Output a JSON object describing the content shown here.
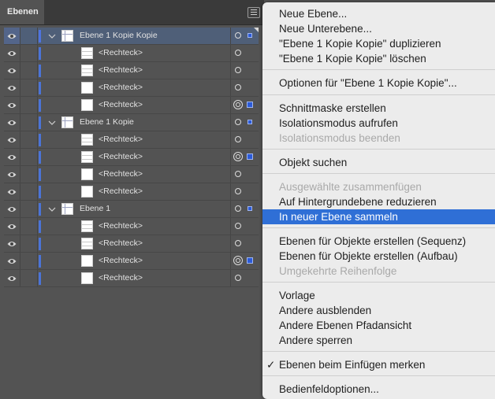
{
  "panel": {
    "tab_label": "Ebenen",
    "accent_color": "#4b74d8",
    "rows": [
      {
        "label": "Ebene 1 Kopie Kopie",
        "kind": "layer",
        "selected": true
      },
      {
        "label": "<Rechteck>",
        "kind": "item"
      },
      {
        "label": "<Rechteck>",
        "kind": "item"
      },
      {
        "label": "<Rechteck>",
        "kind": "item"
      },
      {
        "label": "<Rechteck>",
        "kind": "item"
      },
      {
        "label": "Ebene 1 Kopie",
        "kind": "layer"
      },
      {
        "label": "<Rechteck>",
        "kind": "item"
      },
      {
        "label": "<Rechteck>",
        "kind": "item"
      },
      {
        "label": "<Rechteck>",
        "kind": "item"
      },
      {
        "label": "<Rechteck>",
        "kind": "item"
      },
      {
        "label": "Ebene 1",
        "kind": "layer"
      },
      {
        "label": "<Rechteck>",
        "kind": "item"
      },
      {
        "label": "<Rechteck>",
        "kind": "item"
      },
      {
        "label": "<Rechteck>",
        "kind": "item"
      },
      {
        "label": "<Rechteck>",
        "kind": "item"
      }
    ]
  },
  "menu": {
    "highlight_color": "#2f6fd6",
    "items": [
      {
        "label": "Neue Ebene..."
      },
      {
        "label": "Neue Unterebene..."
      },
      {
        "label": "\"Ebene 1 Kopie Kopie\" duplizieren"
      },
      {
        "label": "\"Ebene 1 Kopie Kopie\" löschen"
      },
      {
        "label": "Optionen für \"Ebene 1 Kopie Kopie\"..."
      },
      {
        "label": "Schnittmaske erstellen"
      },
      {
        "label": "Isolationsmodus aufrufen"
      },
      {
        "label": "Isolationsmodus beenden",
        "disabled": true
      },
      {
        "label": "Objekt suchen"
      },
      {
        "label": "Ausgewählte zusammenfügen",
        "disabled": true
      },
      {
        "label": "Auf Hintergrundebene reduzieren"
      },
      {
        "label": "In neuer Ebene sammeln",
        "highlighted": true
      },
      {
        "label": "Ebenen für Objekte erstellen (Sequenz)"
      },
      {
        "label": "Ebenen für Objekte erstellen (Aufbau)"
      },
      {
        "label": "Umgekehrte Reihenfolge",
        "disabled": true
      },
      {
        "label": "Vorlage"
      },
      {
        "label": "Andere ausblenden"
      },
      {
        "label": "Andere Ebenen Pfadansicht"
      },
      {
        "label": "Andere sperren"
      },
      {
        "label": "Ebenen beim Einfügen merken",
        "checked": true,
        "check_glyph": "✓"
      },
      {
        "label": "Bedienfeldoptionen..."
      }
    ]
  }
}
